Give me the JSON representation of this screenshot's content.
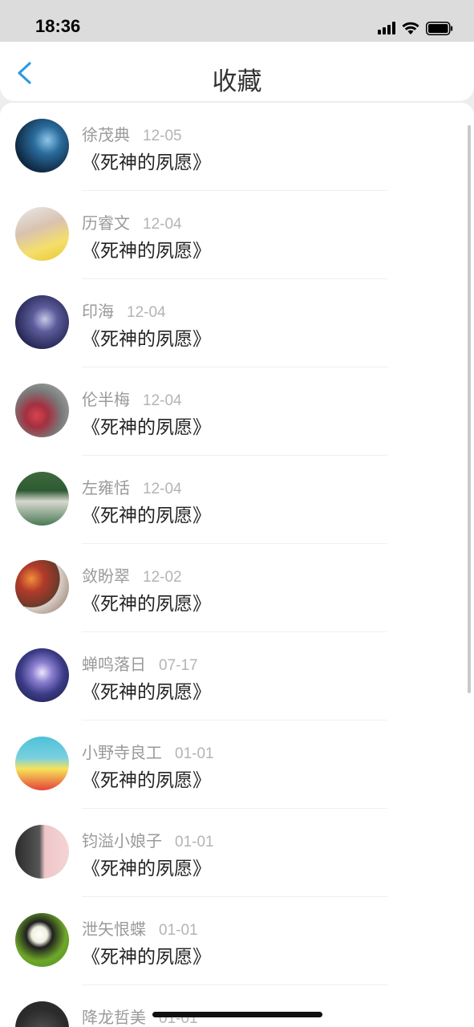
{
  "status_bar": {
    "time": "18:36"
  },
  "header": {
    "title": "收藏"
  },
  "colors": {
    "accent": "#2d9be0"
  },
  "favorites": [
    {
      "name": "徐茂典",
      "date": "12-05",
      "book": "《死神的夙愿》"
    },
    {
      "name": "历睿文",
      "date": "12-04",
      "book": "《死神的夙愿》"
    },
    {
      "name": "印海",
      "date": "12-04",
      "book": "《死神的夙愿》"
    },
    {
      "name": "伦半梅",
      "date": "12-04",
      "book": "《死神的夙愿》"
    },
    {
      "name": "左雍恬",
      "date": "12-04",
      "book": "《死神的夙愿》"
    },
    {
      "name": "敛盼翠",
      "date": "12-02",
      "book": "《死神的夙愿》"
    },
    {
      "name": "蝉鸣落日",
      "date": "07-17",
      "book": "《死神的夙愿》"
    },
    {
      "name": "小野寺良工",
      "date": "01-01",
      "book": "《死神的夙愿》"
    },
    {
      "name": "钧溢小娘子",
      "date": "01-01",
      "book": "《死神的夙愿》"
    },
    {
      "name": "泄矢恨蝶",
      "date": "01-01",
      "book": "《死神的夙愿》"
    },
    {
      "name": "降龙哲美",
      "date": "01-01",
      "book": ""
    }
  ]
}
